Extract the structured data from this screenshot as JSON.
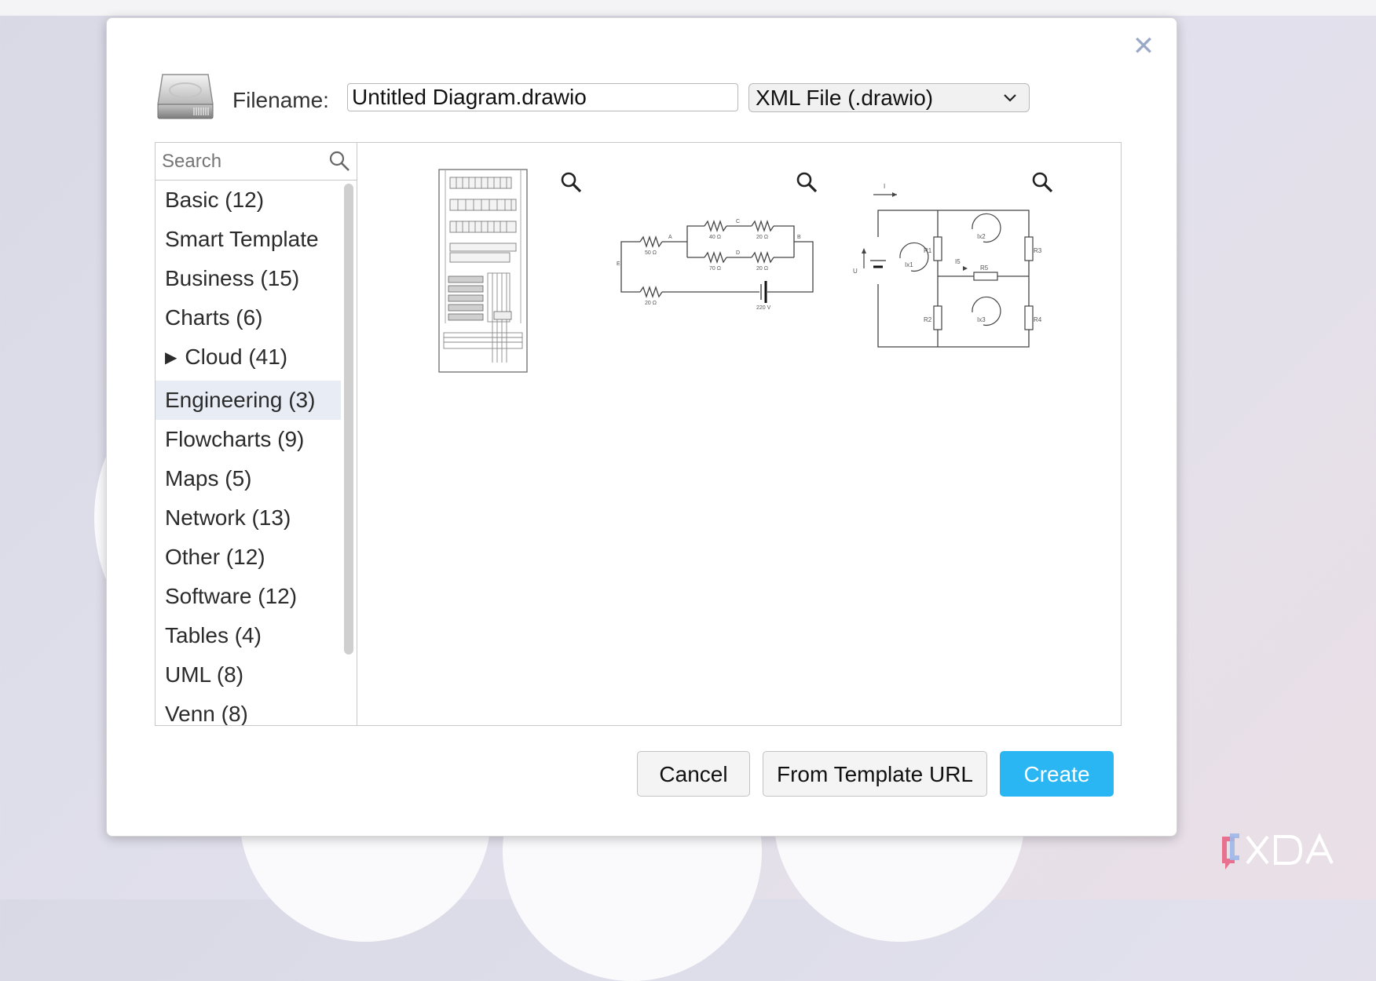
{
  "dialog": {
    "filename_label": "Filename:",
    "filename_value": "Untitled Diagram.drawio",
    "format_selected": "XML File (.drawio)",
    "search_placeholder": "Search",
    "categories": [
      {
        "label": "Basic (12)"
      },
      {
        "label": "Smart Template"
      },
      {
        "label": "Business (15)"
      },
      {
        "label": "Charts (6)"
      },
      {
        "label": "Cloud (41)",
        "expandable": true
      },
      {
        "label": "Engineering (3)",
        "selected": true
      },
      {
        "label": "Flowcharts (9)"
      },
      {
        "label": "Maps (5)"
      },
      {
        "label": "Network (13)"
      },
      {
        "label": "Other (12)"
      },
      {
        "label": "Software (12)"
      },
      {
        "label": "Tables (4)"
      },
      {
        "label": "UML (8)"
      },
      {
        "label": "Venn (8)"
      }
    ],
    "buttons": {
      "cancel": "Cancel",
      "from_template_url": "From Template URL",
      "create": "Create"
    }
  },
  "templates": {
    "circuit_labels": [
      "50 Ω",
      "40 Ω",
      "20 Ω",
      "70 Ω",
      "20 Ω",
      "20 Ω",
      "220 V",
      "A",
      "B",
      "C",
      "D",
      "E"
    ],
    "network_labels": [
      "I",
      "R1",
      "R2",
      "R3",
      "R4",
      "R5",
      "I5",
      "U",
      "Ix1",
      "Ix2",
      "Ix3"
    ]
  },
  "watermark": {
    "text": "XDA"
  },
  "colors": {
    "accent": "#29b6f2",
    "selected_bg": "#e8ecf5",
    "close": "#9aa9c7"
  }
}
